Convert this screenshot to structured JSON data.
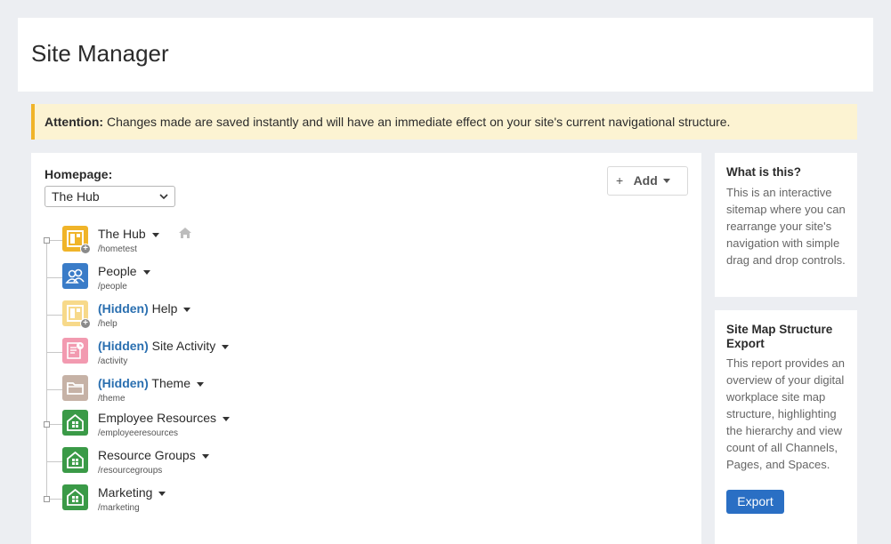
{
  "header": {
    "title": "Site Manager"
  },
  "attention": {
    "label": "Attention:",
    "text": "Changes made are saved instantly and will have an immediate effect on your site's current navigational structure."
  },
  "homepage": {
    "label": "Homepage:",
    "selected": "The Hub"
  },
  "toolbar": {
    "add_plus": "+",
    "add_label": "Add"
  },
  "tree": {
    "hidden_tag": "(Hidden)",
    "items": [
      {
        "name": "The Hub",
        "path": "/hometest",
        "hidden": false,
        "icon": "layout-plus-icon",
        "color": "#f0b429",
        "home": true
      },
      {
        "name": "People",
        "path": "/people",
        "hidden": false,
        "icon": "people-icon",
        "color": "#3a7cc8"
      },
      {
        "name": "Help",
        "path": "/help",
        "hidden": true,
        "icon": "layout-plus-icon",
        "color": "#f7d98a"
      },
      {
        "name": "Site Activity",
        "path": "/activity",
        "hidden": true,
        "icon": "activity-icon",
        "color": "#f29ab0"
      },
      {
        "name": "Theme",
        "path": "/theme",
        "hidden": true,
        "icon": "folder-icon",
        "color": "#c6b2a6"
      },
      {
        "name": "Employee Resources",
        "path": "/employeeresources",
        "hidden": false,
        "icon": "space-icon",
        "color": "#3a9a47"
      },
      {
        "name": "Resource Groups",
        "path": "/resourcegroups",
        "hidden": false,
        "icon": "space-icon",
        "color": "#3a9a47"
      },
      {
        "name": "Marketing",
        "path": "/marketing",
        "hidden": false,
        "icon": "space-icon",
        "color": "#3a9a47"
      }
    ]
  },
  "help_panel": {
    "title": "What is this?",
    "text": "This is an interactive sitemap where you can rearrange your site's navigation with simple drag and drop controls."
  },
  "export_panel": {
    "title": "Site Map Structure Export",
    "text": "This report provides an overview of your digital workplace site map structure, highlighting the hierarchy and view count of all Channels, Pages, and Spaces.",
    "button_label": "Export"
  },
  "colors": {
    "accent": "#2a6fc4",
    "hidden_tag": "#2a6fb0",
    "attention_bg": "#fcf3d2",
    "attention_border": "#f0b429"
  }
}
